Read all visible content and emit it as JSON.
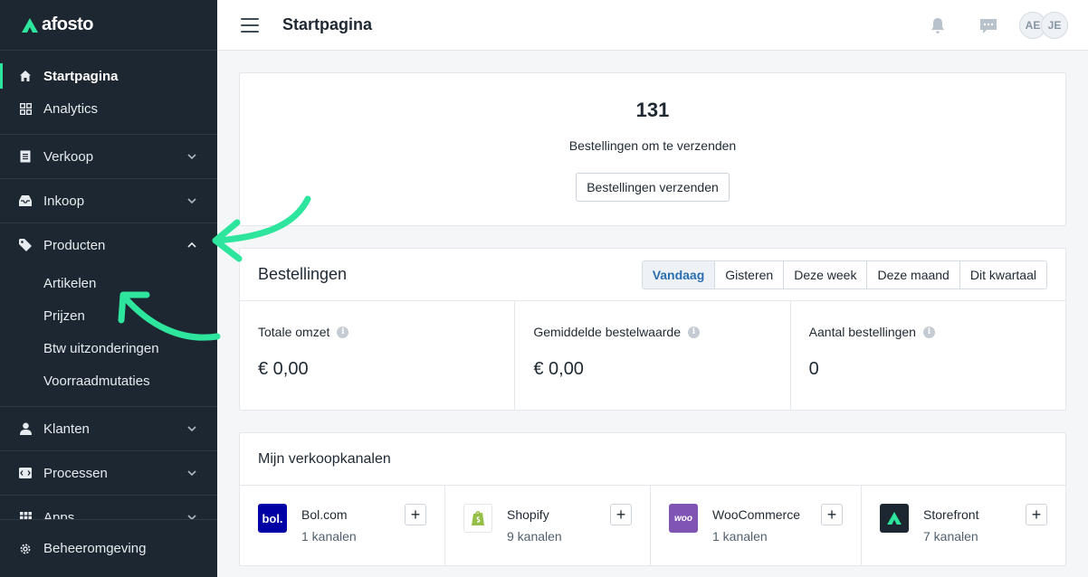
{
  "brand": {
    "name": "afosto"
  },
  "sidebar": {
    "primary": [
      {
        "label": "Startpagina",
        "icon": "home-icon",
        "active": true
      },
      {
        "label": "Analytics",
        "icon": "grid-icon"
      }
    ],
    "groups": [
      {
        "label": "Verkoop",
        "icon": "document-icon",
        "expanded": false
      },
      {
        "label": "Inkoop",
        "icon": "inbox-icon",
        "expanded": false
      },
      {
        "label": "Producten",
        "icon": "tag-icon",
        "expanded": true,
        "children": [
          "Artikelen",
          "Prijzen",
          "Btw uitzonderingen",
          "Voorraadmutaties"
        ]
      },
      {
        "label": "Klanten",
        "icon": "user-icon",
        "expanded": false
      },
      {
        "label": "Processen",
        "icon": "process-icon",
        "expanded": false
      },
      {
        "label": "Apps",
        "icon": "apps-icon",
        "expanded": false
      }
    ],
    "footer": {
      "label": "Beheeromgeving",
      "icon": "gear-icon"
    }
  },
  "topbar": {
    "title": "Startpagina",
    "avatars": [
      "AE",
      "JE"
    ]
  },
  "shipping": {
    "count": "131",
    "label": "Bestellingen om te verzenden",
    "button": "Bestellingen verzenden"
  },
  "orders": {
    "title": "Bestellingen",
    "ranges": [
      "Vandaag",
      "Gisteren",
      "Deze week",
      "Deze maand",
      "Dit kwartaal"
    ],
    "active_range": "Vandaag",
    "stats": [
      {
        "label": "Totale omzet",
        "value": "€ 0,00"
      },
      {
        "label": "Gemiddelde bestelwaarde",
        "value": "€ 0,00"
      },
      {
        "label": "Aantal bestellingen",
        "value": "0"
      }
    ]
  },
  "channels": {
    "title": "Mijn verkoopkanalen",
    "items": [
      {
        "name": "Bol.com",
        "count": "1 kanalen",
        "logo": "bol.",
        "color": "#0000a4"
      },
      {
        "name": "Shopify",
        "count": "9 kanalen",
        "logo": "shopify-icon",
        "color": "#95bf47"
      },
      {
        "name": "WooCommerce",
        "count": "1 kanalen",
        "logo": "woo",
        "color": "#7f54b3"
      },
      {
        "name": "Storefront",
        "count": "7 kanalen",
        "logo": "storefront-icon",
        "color": "#1d2731"
      }
    ]
  },
  "colors": {
    "accent": "#2ee59d",
    "sidebar": "#1d2731",
    "active_tab": "#2a6fb0"
  }
}
